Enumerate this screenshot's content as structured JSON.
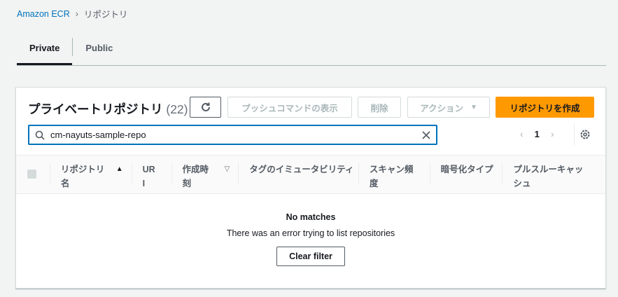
{
  "breadcrumb": {
    "root": "Amazon ECR",
    "current": "リポジトリ"
  },
  "tabs": [
    {
      "label": "Private"
    },
    {
      "label": "Public"
    }
  ],
  "panel": {
    "title": "プライベートリポジトリ",
    "count": "(22)",
    "buttons": {
      "push": "プッシュコマンドの表示",
      "delete": "削除",
      "actions": "アクション",
      "create": "リポジトリを作成"
    },
    "search": {
      "value": "cm-nayuts-sample-repo"
    },
    "pager": {
      "page": "1"
    },
    "columns": [
      {
        "label": "リポジトリ名"
      },
      {
        "label": "URI"
      },
      {
        "label": "作成時刻"
      },
      {
        "label": "タグのイミュータビリティ"
      },
      {
        "label": "スキャン頻度"
      },
      {
        "label": "暗号化タイプ"
      },
      {
        "label": "プルスルーキャッシュ"
      }
    ],
    "empty": {
      "title": "No matches",
      "message": "There was an error trying to list repositories",
      "clear": "Clear filter"
    }
  },
  "colors": {
    "primary": "#ff9900",
    "link": "#0073bb"
  }
}
